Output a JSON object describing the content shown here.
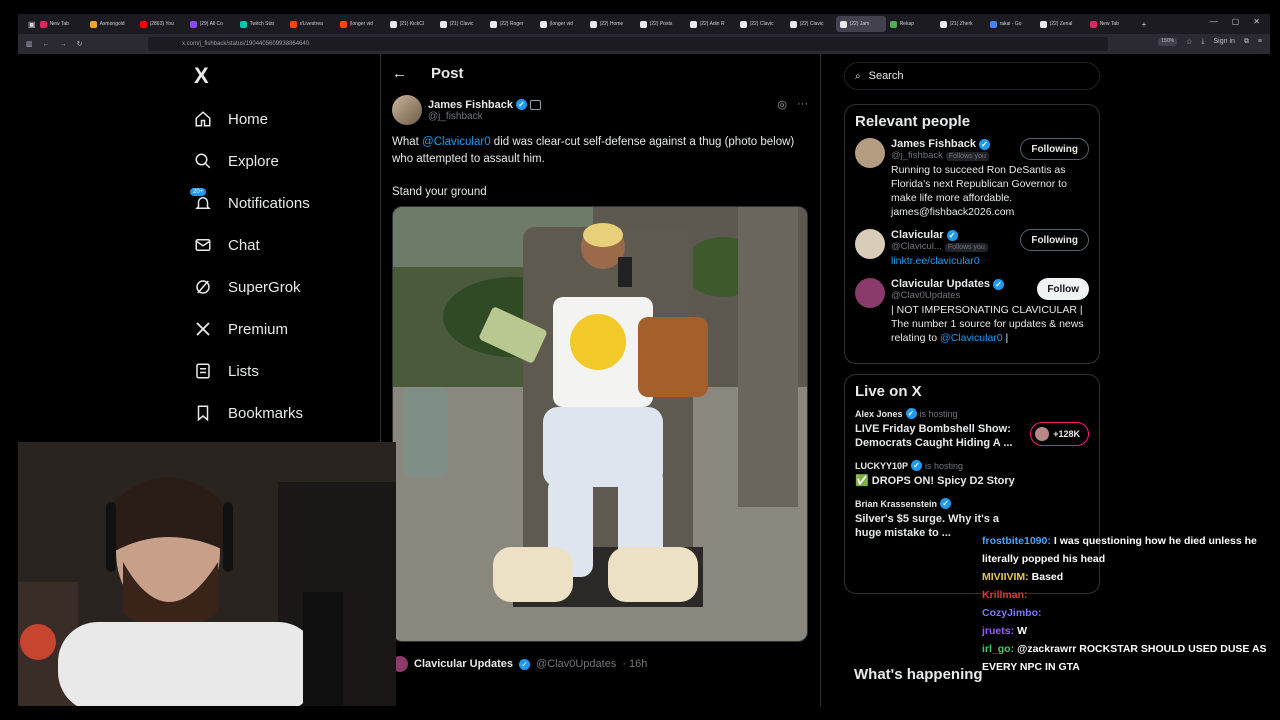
{
  "browser": {
    "tabs": [
      {
        "label": "New Tab",
        "color": "#e0245e"
      },
      {
        "label": "Asmongold",
        "color": "#f5a623"
      },
      {
        "label": "(2863) You",
        "color": "#ff0000"
      },
      {
        "label": "(29) All Co",
        "color": "#9146ff"
      },
      {
        "label": "Twitch Stat",
        "color": "#00c8af"
      },
      {
        "label": "r/Livestrea",
        "color": "#ff4500"
      },
      {
        "label": "(longer vid",
        "color": "#ff4500"
      },
      {
        "label": "(21) KickCl",
        "color": "#e7e9ea"
      },
      {
        "label": "(21) Clavic",
        "color": "#e7e9ea"
      },
      {
        "label": "(22) Roger",
        "color": "#e7e9ea"
      },
      {
        "label": "(longer vid",
        "color": "#e7e9ea"
      },
      {
        "label": "(22) Home",
        "color": "#e7e9ea"
      },
      {
        "label": "(22) Posts",
        "color": "#e7e9ea"
      },
      {
        "label": "(22) Adin R",
        "color": "#e7e9ea"
      },
      {
        "label": "(22) Clavic",
        "color": "#e7e9ea"
      },
      {
        "label": "(22) Clavic",
        "color": "#e7e9ea"
      },
      {
        "label": "(22) Jam",
        "color": "#e7e9ea"
      },
      {
        "label": "Rekap",
        "color": "#4caf50"
      },
      {
        "label": "(21) Zherk",
        "color": "#e7e9ea"
      },
      {
        "label": "rakai - Go",
        "color": "#4285f4"
      },
      {
        "label": "(22) Zenal",
        "color": "#e7e9ea"
      },
      {
        "label": "New Tab",
        "color": "#e0245e"
      }
    ],
    "active_tab_index": 16,
    "url": "x.com/j_fishback/status/1904405609938864640",
    "zoom": "150%",
    "sign_in": "Sign in"
  },
  "nav": {
    "logo": "X",
    "items": [
      {
        "label": "Home",
        "icon": "home-icon"
      },
      {
        "label": "Explore",
        "icon": "search-icon"
      },
      {
        "label": "Notifications",
        "icon": "bell-icon",
        "badge": "20+"
      },
      {
        "label": "Chat",
        "icon": "mail-icon"
      },
      {
        "label": "SuperGrok",
        "icon": "grok-icon"
      },
      {
        "label": "Premium",
        "icon": "x-icon"
      },
      {
        "label": "Lists",
        "icon": "list-icon"
      },
      {
        "label": "Bookmarks",
        "icon": "bookmark-icon"
      }
    ]
  },
  "post": {
    "header_title": "Post",
    "author_name": "James Fishback",
    "author_handle": "@j_fishback",
    "text_prefix": "What ",
    "mention": "@Clavicular0",
    "text_suffix": " did was clear-cut self-defense against a thug (photo below) who attempted to assault him.",
    "text2": "Stand your ground",
    "quote_name": "Clavicular Updates",
    "quote_handle": "@Clav0Updates",
    "quote_time": "· 16h"
  },
  "right": {
    "search_placeholder": "Search",
    "relevant_title": "Relevant people",
    "people": [
      {
        "name": "James Fishback",
        "handle": "@j_fishback",
        "follows_you": "Follows you",
        "bio": "Running to succeed Ron DeSantis as Florida's next Republican Governor to make life more affordable. james@fishback2026.com",
        "button": "Following",
        "avatar_color": "#b49c80"
      },
      {
        "name": "Clavicular",
        "handle": "@Clavicul...",
        "follows_you": "Follows you",
        "bio_link": "linktr.ee/clavicular0",
        "button": "Following",
        "avatar_color": "#d8cbb8"
      },
      {
        "name": "Clavicular Updates",
        "handle": "@Clav0Updates",
        "bio_prefix": "| NOT IMPERSONATING CLAVICULAR | The number 1 source for updates & news relating to ",
        "bio_mention": "@Clavicular0",
        "bio_suffix": " |",
        "button": "Follow",
        "avatar_color": "#8a3a6b"
      }
    ],
    "live_title": "Live on X",
    "live": [
      {
        "host": "Alex Jones",
        "status": "is hosting",
        "title": "LIVE Friday Bombshell Show: Democrats Caught Hiding A ...",
        "count": "+128K"
      },
      {
        "host": "LUCKYY10P",
        "status": "is hosting",
        "title": "✅ DROPS ON! Spicy D2 Story"
      },
      {
        "host": "Brian Krassenstein",
        "status": "",
        "title": "Silver's $5 surge. Why it's a huge mistake to ..."
      }
    ],
    "happening_title": "What's happening"
  },
  "chat": [
    {
      "user": "frostbite1090:",
      "user_color": "#4aa3ff",
      "msg": "I was questioning how he died unless he literally popped his head"
    },
    {
      "user": "MIVIIVIM:",
      "user_color": "#e6c84a",
      "msg": "Based"
    },
    {
      "user": "Krillman:",
      "user_color": "#e03a3a",
      "msg": ""
    },
    {
      "user": "CozyJimbo:",
      "user_color": "#7a7aff",
      "msg": ""
    },
    {
      "user": "jruets:",
      "user_color": "#9b59ff",
      "msg": "W"
    },
    {
      "user": "irl_go:",
      "user_color": "#3ad16a",
      "msg": "@zackrawrr ROCKSTAR SHOULD USED DUSE AS EVERY NPC IN GTA"
    }
  ]
}
